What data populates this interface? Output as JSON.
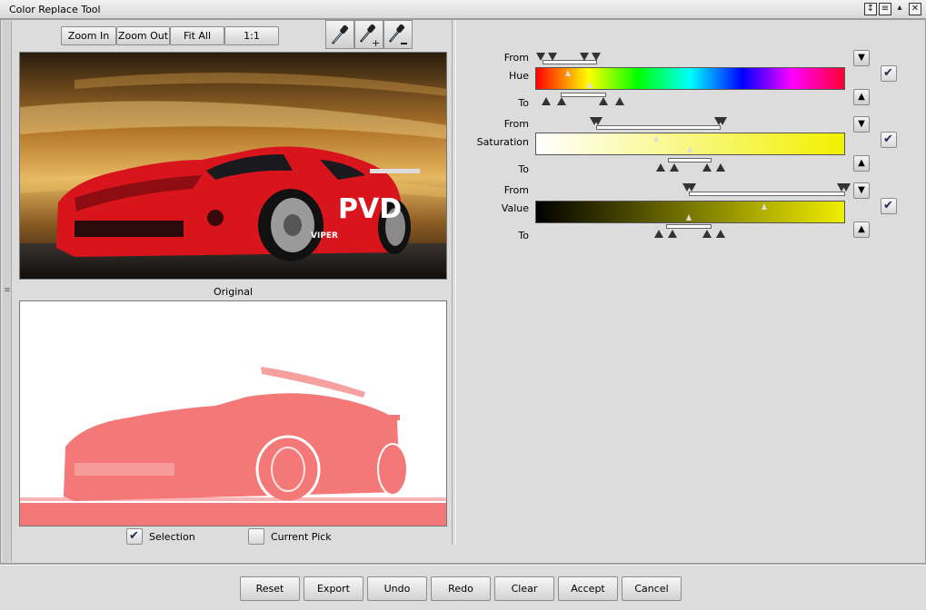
{
  "window": {
    "title": "Color Replace Tool"
  },
  "toolbar": {
    "zoom_in": "Zoom In",
    "zoom_out": "Zoom Out",
    "fit_all": "Fit All",
    "one_to_one": "1:1",
    "tools": [
      "eyedropper-icon",
      "eyedropper-add-icon",
      "eyedropper-subtract-icon"
    ]
  },
  "preview": {
    "original_label": "Original",
    "car_text": "PVD",
    "car_side_text": "VIPER",
    "selection_label": "Selection",
    "current_pick_label": "Current Pick",
    "selection_checked": true,
    "current_pick_checked": false
  },
  "sliders": {
    "from_label": "From",
    "to_label": "To",
    "hue": {
      "label": "Hue",
      "enabled": true
    },
    "saturation": {
      "label": "Saturation",
      "enabled": true
    },
    "value": {
      "label": "Value",
      "enabled": true
    }
  },
  "footer": {
    "reset": "Reset",
    "export": "Export",
    "undo": "Undo",
    "redo": "Redo",
    "clear": "Clear",
    "accept": "Accept",
    "cancel": "Cancel"
  },
  "colors": {
    "selection_tint": "#f47878",
    "car_red": "#d8141c",
    "check_color": "#1b2b55"
  }
}
